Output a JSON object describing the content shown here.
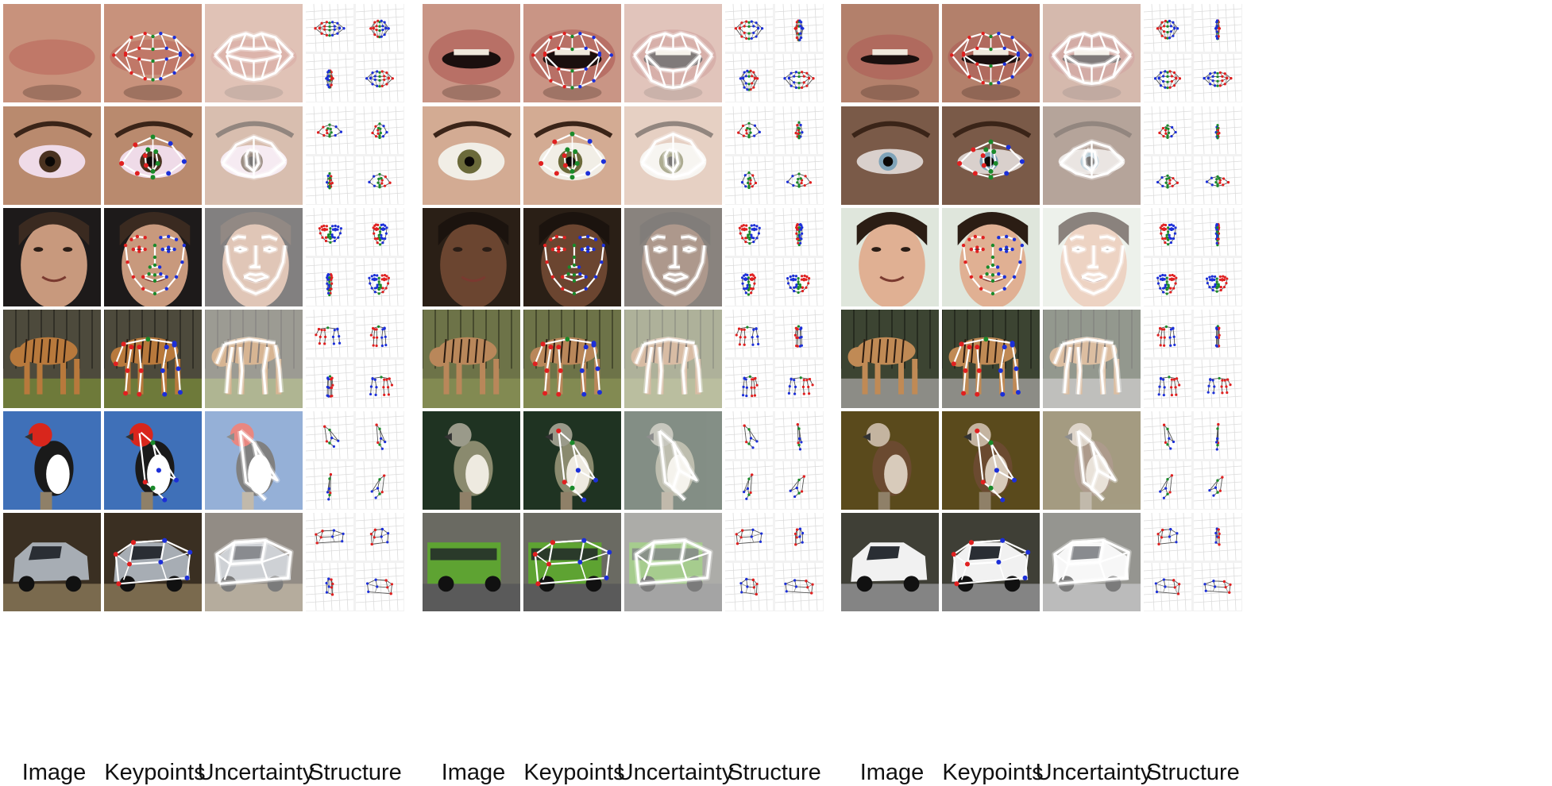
{
  "captions": {
    "image": "Image",
    "keypoints": "Keypoints",
    "uncertainty": "Uncertainty",
    "structure": "Structure"
  },
  "figure": {
    "rows": [
      "mouth",
      "eye",
      "face",
      "tiger",
      "bird",
      "car"
    ],
    "columns": [
      "image",
      "keypoints",
      "uncertainty",
      "structure"
    ],
    "examples": 3
  },
  "colors": {
    "skin_light": "#d9a592",
    "skin_mid": "#b8836e",
    "skin_dark": "#6e4a3a",
    "iris_brown": "#4a3220",
    "sclera": "#efd9e6",
    "grass": "#6b7a3c",
    "sky_blue": "#3d6fb8",
    "leaf_green": "#9fb83a",
    "car_grey": "#9aa0a6",
    "bus_green": "#5da032",
    "kp_red": "#e02020",
    "kp_blue": "#1c2fd8",
    "kp_green": "#1a8a2a",
    "skeleton": "#ffffff",
    "structure_bg": "#f2f2f2"
  }
}
